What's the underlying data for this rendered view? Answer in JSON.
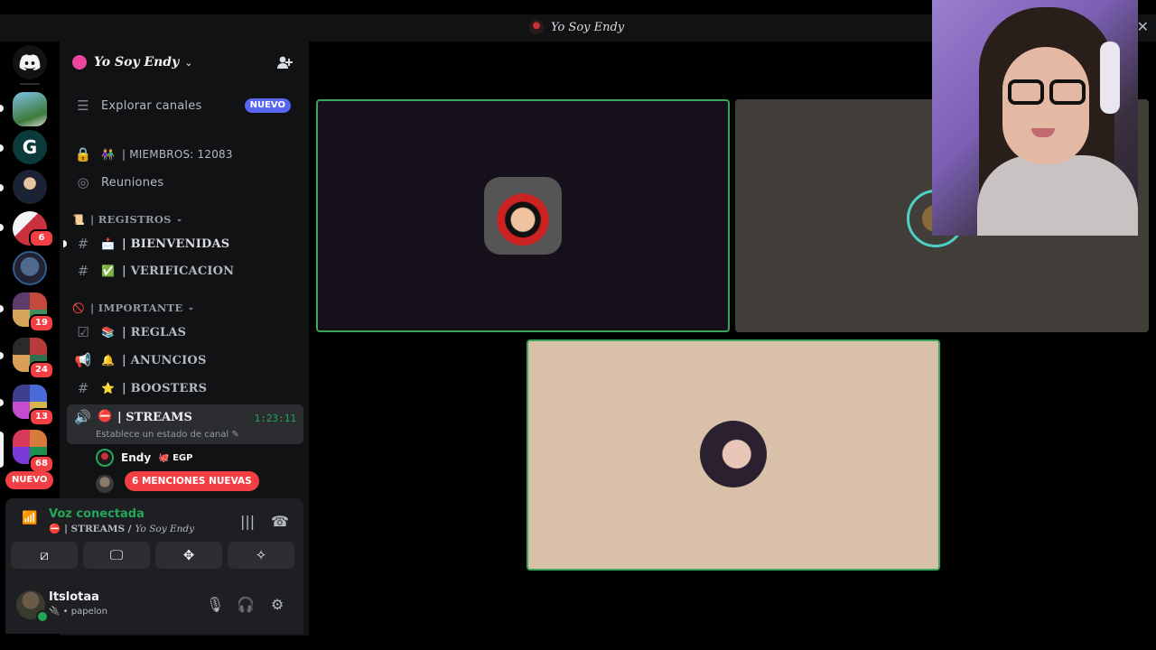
{
  "window": {
    "title": "Yo Soy Endy",
    "close_icon": "close-icon"
  },
  "rail": {
    "badges": [
      "6",
      "19",
      "24",
      "13",
      "68"
    ],
    "nuevo_label": "NUEVO"
  },
  "server": {
    "name": "Yo Soy Endy",
    "header_icon": "chevron-down-icon"
  },
  "channels": {
    "explore_label": "Explorar canales",
    "explore_badge": "NUEVO",
    "members_label": "MIEMBROS: 12083",
    "members_emoji": "👫",
    "meetings_label": "Reuniones",
    "categories": [
      {
        "emoji": "📜",
        "label": "| REGISTROS"
      },
      {
        "emoji": "🚫",
        "label": "| IMPORTANTE"
      }
    ],
    "items": [
      {
        "emoji": "📩",
        "label": "| BIENVENIDAS"
      },
      {
        "emoji": "✅",
        "label": "| VERIFICACION"
      },
      {
        "emoji": "📚",
        "label": "| REGLAS"
      },
      {
        "emoji": "🔔",
        "label": "| ANUNCIOS"
      },
      {
        "emoji": "⭐",
        "label": "| BOOSTERS"
      }
    ],
    "active": {
      "emoji": "⛔",
      "label": "| STREAMS",
      "timer": "1:23:11",
      "status": "Establece un estado de canal ✎"
    },
    "voice_users": [
      {
        "name": "Endy",
        "tag": "🐙 EGP"
      }
    ],
    "mentions_label": "6 MENCIONES NUEVAS"
  },
  "voice_panel": {
    "title": "Voz conectada",
    "channel_emoji": "⛔",
    "channel": "| STREAMS /",
    "server": "Yo Soy Endy"
  },
  "user": {
    "name": "Itslotaa",
    "status": "• papelon",
    "status_emoji": "🔌"
  },
  "colors": {
    "accent_green": "#23a55a",
    "tile_border": "#3ba55c",
    "badge_red": "#f23f43",
    "blurple": "#5865f2"
  }
}
